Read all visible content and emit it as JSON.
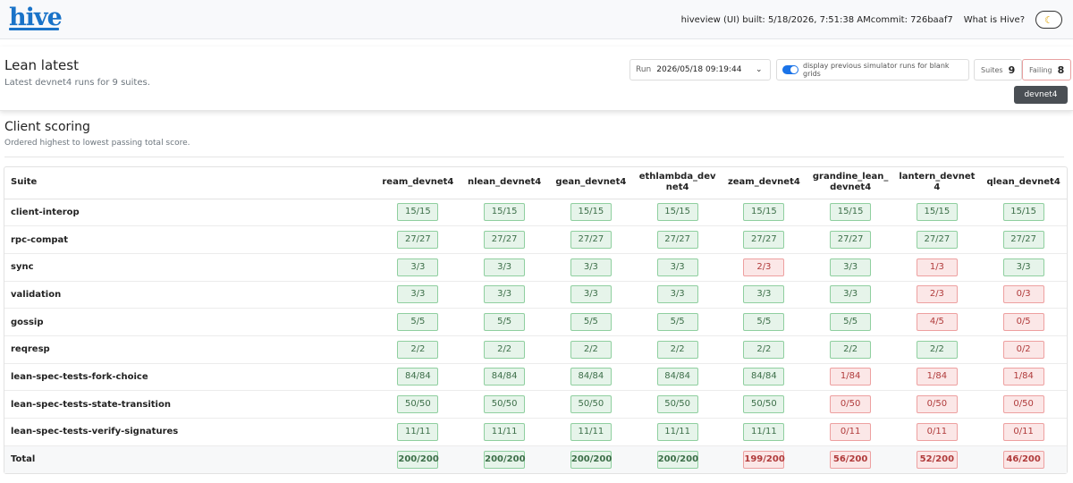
{
  "topbar": {
    "logo": "hive",
    "build_info": "hiveview (UI) built: 5/18/2026, 7:51:38 AMcommit: 726baaf7",
    "what_is": "What is Hive?",
    "theme_icon": "moon-icon"
  },
  "header": {
    "title": "Lean latest",
    "subtitle": "Latest devnet4 runs for 9 suites.",
    "run_label": "Run",
    "run_value": "2026/05/18 09:19:44",
    "toggle_label": "display previous simulator runs for blank grids",
    "suites_label": "Suites",
    "suites_count": "9",
    "failing_label": "Failing",
    "failing_count": "8",
    "tag": "devnet4"
  },
  "scoring": {
    "title": "Client scoring",
    "subtitle": "Ordered highest to lowest passing total score."
  },
  "table": {
    "suite_header": "Suite",
    "clients": [
      "ream_devnet4",
      "nlean_devnet4",
      "gean_devnet4",
      "ethlambda_devnet4",
      "zeam_devnet4",
      "grandine_lean_devnet4",
      "lantern_devnet4",
      "qlean_devnet4"
    ],
    "rows": [
      {
        "suite": "client-interop",
        "cells": [
          {
            "v": "15/15",
            "s": "pass"
          },
          {
            "v": "15/15",
            "s": "pass"
          },
          {
            "v": "15/15",
            "s": "pass"
          },
          {
            "v": "15/15",
            "s": "pass"
          },
          {
            "v": "15/15",
            "s": "pass"
          },
          {
            "v": "15/15",
            "s": "pass"
          },
          {
            "v": "15/15",
            "s": "pass"
          },
          {
            "v": "15/15",
            "s": "pass"
          }
        ]
      },
      {
        "suite": "rpc-compat",
        "cells": [
          {
            "v": "27/27",
            "s": "pass"
          },
          {
            "v": "27/27",
            "s": "pass"
          },
          {
            "v": "27/27",
            "s": "pass"
          },
          {
            "v": "27/27",
            "s": "pass"
          },
          {
            "v": "27/27",
            "s": "pass"
          },
          {
            "v": "27/27",
            "s": "pass"
          },
          {
            "v": "27/27",
            "s": "pass"
          },
          {
            "v": "27/27",
            "s": "pass"
          }
        ]
      },
      {
        "suite": "sync",
        "cells": [
          {
            "v": "3/3",
            "s": "pass"
          },
          {
            "v": "3/3",
            "s": "pass"
          },
          {
            "v": "3/3",
            "s": "pass"
          },
          {
            "v": "3/3",
            "s": "pass"
          },
          {
            "v": "2/3",
            "s": "fail"
          },
          {
            "v": "3/3",
            "s": "pass"
          },
          {
            "v": "1/3",
            "s": "fail"
          },
          {
            "v": "3/3",
            "s": "pass"
          }
        ]
      },
      {
        "suite": "validation",
        "cells": [
          {
            "v": "3/3",
            "s": "pass"
          },
          {
            "v": "3/3",
            "s": "pass"
          },
          {
            "v": "3/3",
            "s": "pass"
          },
          {
            "v": "3/3",
            "s": "pass"
          },
          {
            "v": "3/3",
            "s": "pass"
          },
          {
            "v": "3/3",
            "s": "pass"
          },
          {
            "v": "2/3",
            "s": "fail"
          },
          {
            "v": "0/3",
            "s": "fail"
          }
        ]
      },
      {
        "suite": "gossip",
        "cells": [
          {
            "v": "5/5",
            "s": "pass"
          },
          {
            "v": "5/5",
            "s": "pass"
          },
          {
            "v": "5/5",
            "s": "pass"
          },
          {
            "v": "5/5",
            "s": "pass"
          },
          {
            "v": "5/5",
            "s": "pass"
          },
          {
            "v": "5/5",
            "s": "pass"
          },
          {
            "v": "4/5",
            "s": "fail"
          },
          {
            "v": "0/5",
            "s": "fail"
          }
        ]
      },
      {
        "suite": "reqresp",
        "cells": [
          {
            "v": "2/2",
            "s": "pass"
          },
          {
            "v": "2/2",
            "s": "pass"
          },
          {
            "v": "2/2",
            "s": "pass"
          },
          {
            "v": "2/2",
            "s": "pass"
          },
          {
            "v": "2/2",
            "s": "pass"
          },
          {
            "v": "2/2",
            "s": "pass"
          },
          {
            "v": "2/2",
            "s": "pass"
          },
          {
            "v": "0/2",
            "s": "fail"
          }
        ]
      },
      {
        "suite": "lean-spec-tests-fork-choice",
        "cells": [
          {
            "v": "84/84",
            "s": "pass"
          },
          {
            "v": "84/84",
            "s": "pass"
          },
          {
            "v": "84/84",
            "s": "pass"
          },
          {
            "v": "84/84",
            "s": "pass"
          },
          {
            "v": "84/84",
            "s": "pass"
          },
          {
            "v": "1/84",
            "s": "fail"
          },
          {
            "v": "1/84",
            "s": "fail"
          },
          {
            "v": "1/84",
            "s": "fail"
          }
        ]
      },
      {
        "suite": "lean-spec-tests-state-transition",
        "cells": [
          {
            "v": "50/50",
            "s": "pass"
          },
          {
            "v": "50/50",
            "s": "pass"
          },
          {
            "v": "50/50",
            "s": "pass"
          },
          {
            "v": "50/50",
            "s": "pass"
          },
          {
            "v": "50/50",
            "s": "pass"
          },
          {
            "v": "0/50",
            "s": "fail"
          },
          {
            "v": "0/50",
            "s": "fail"
          },
          {
            "v": "0/50",
            "s": "fail"
          }
        ]
      },
      {
        "suite": "lean-spec-tests-verify-signatures",
        "cells": [
          {
            "v": "11/11",
            "s": "pass"
          },
          {
            "v": "11/11",
            "s": "pass"
          },
          {
            "v": "11/11",
            "s": "pass"
          },
          {
            "v": "11/11",
            "s": "pass"
          },
          {
            "v": "11/11",
            "s": "pass"
          },
          {
            "v": "0/11",
            "s": "fail"
          },
          {
            "v": "0/11",
            "s": "fail"
          },
          {
            "v": "0/11",
            "s": "fail"
          }
        ]
      }
    ],
    "total": {
      "suite": "Total",
      "cells": [
        {
          "v": "200/200",
          "s": "pass"
        },
        {
          "v": "200/200",
          "s": "pass"
        },
        {
          "v": "200/200",
          "s": "pass"
        },
        {
          "v": "200/200",
          "s": "pass"
        },
        {
          "v": "199/200",
          "s": "fail"
        },
        {
          "v": "56/200",
          "s": "fail"
        },
        {
          "v": "52/200",
          "s": "fail"
        },
        {
          "v": "46/200",
          "s": "fail"
        }
      ]
    }
  },
  "colors": {
    "accent": "#1a73c8",
    "pass_bg": "#e6f4ea",
    "fail_bg": "#fbe7e7"
  }
}
